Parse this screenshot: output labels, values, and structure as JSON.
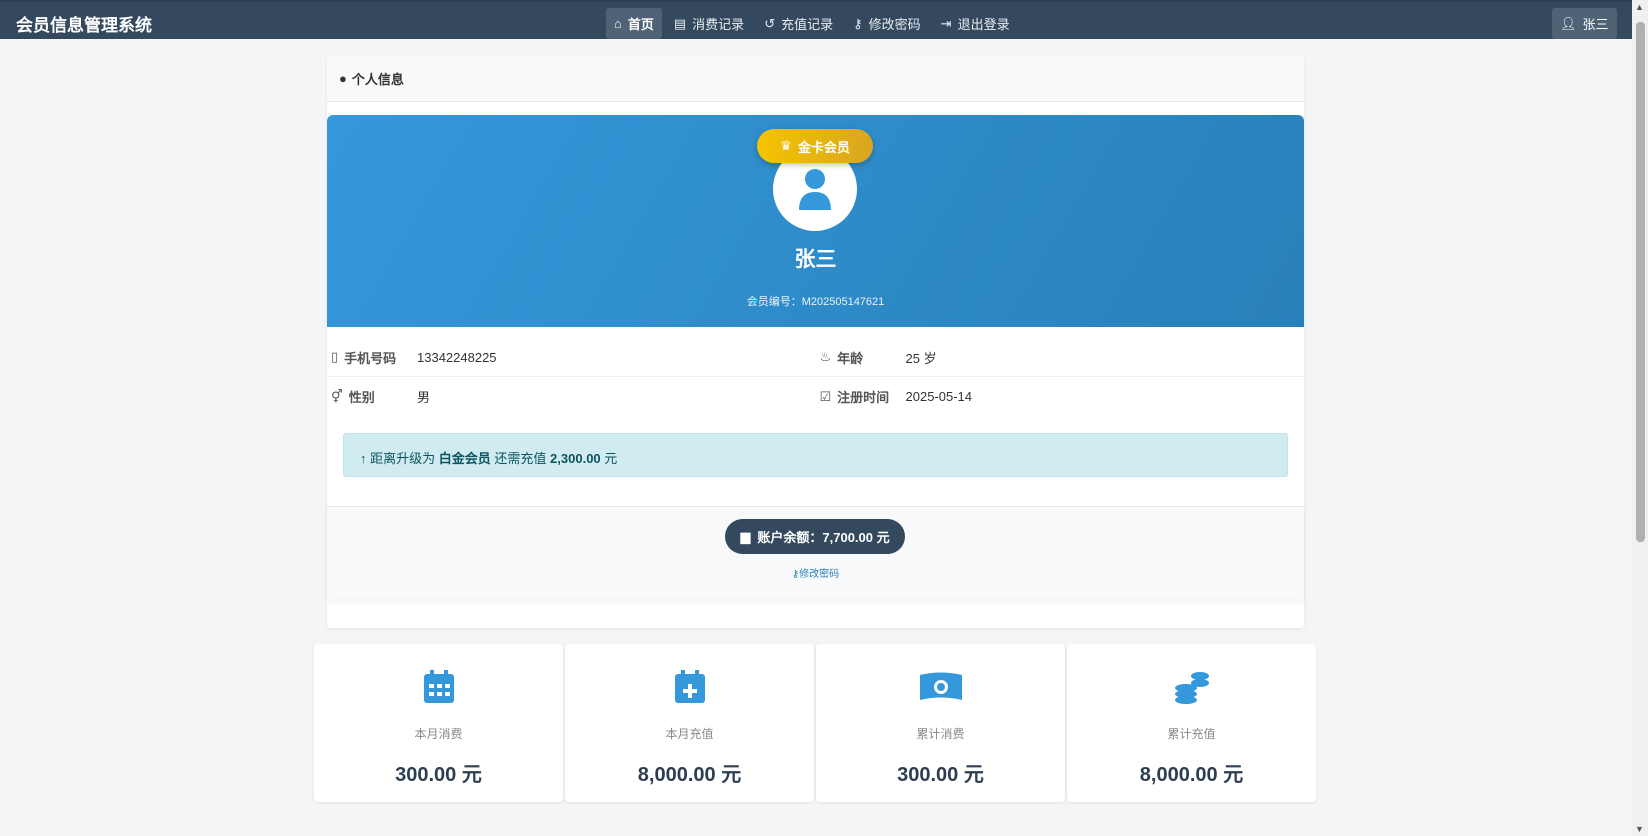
{
  "navbar": {
    "brand": "会员信息管理系统",
    "links": [
      {
        "label": "首页",
        "icon": "home-icon"
      },
      {
        "label": "消费记录",
        "icon": "list-icon"
      },
      {
        "label": "充值记录",
        "icon": "history-icon"
      },
      {
        "label": "修改密码",
        "icon": "key-icon"
      },
      {
        "label": "退出登录",
        "icon": "sign-out-icon"
      }
    ],
    "user": "张三"
  },
  "card": {
    "title": "个人信息",
    "level": "金卡会员",
    "name": "张三",
    "member_no": "会员编号：M202505147621",
    "fields": {
      "phone_label": "手机号码",
      "phone": "13342248225",
      "age_label": "年龄",
      "age": "25 岁",
      "gender_label": "性别",
      "gender": "男",
      "reg_label": "注册时间",
      "reg": "2025-05-14"
    },
    "upgrade": {
      "prefix": "距离升级为",
      "level": "白金会员",
      "middle": "还需充值",
      "amount": "2,300.00",
      "unit": "元"
    },
    "balance": "账户余额：7,700.00 元",
    "change_password": "修改密码"
  },
  "stats": [
    {
      "label": "本月消费",
      "value": "300.00 元",
      "icon": "calendar-icon"
    },
    {
      "label": "本月充值",
      "value": "8,000.00 元",
      "icon": "calendar-plus-icon"
    },
    {
      "label": "累计消费",
      "value": "300.00 元",
      "icon": "money-bill-icon"
    },
    {
      "label": "累计充值",
      "value": "8,000.00 元",
      "icon": "coins-icon"
    }
  ],
  "colors": {
    "nav": "#34495e",
    "primary": "#3498db",
    "gold": "#f5c400"
  }
}
